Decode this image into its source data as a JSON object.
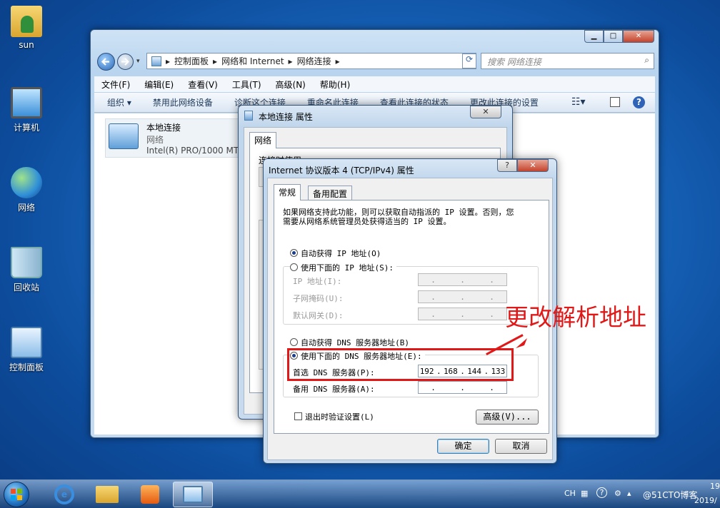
{
  "desktop": {
    "icons": [
      {
        "label": "sun"
      },
      {
        "label": "计算机"
      },
      {
        "label": "网络"
      },
      {
        "label": "回收站"
      },
      {
        "label": "控制面板"
      }
    ]
  },
  "explorer": {
    "min": "▁",
    "max": "□",
    "close": "✕",
    "breadcrumb": [
      "控制面板",
      "网络和 Internet",
      "网络连接"
    ],
    "search_placeholder": "搜索 网络连接",
    "menu": [
      "文件(F)",
      "编辑(E)",
      "查看(V)",
      "工具(T)",
      "高级(N)",
      "帮助(H)"
    ],
    "commands": [
      "组织 ▾",
      "禁用此网络设备",
      "诊断这个连接",
      "重命名此连接",
      "查看此连接的状态",
      "更改此连接的设置"
    ],
    "adapter": {
      "name": "本地连接",
      "network": "网络",
      "device": "Intel(R) PRO/1000 MT"
    }
  },
  "local_props": {
    "title": "本地连接 属性",
    "close": "✕",
    "tab": "网络",
    "connect_using": "连接时使用:"
  },
  "ipv4": {
    "title": "Internet 协议版本 4 (TCP/IPv4) 属性",
    "help": "?",
    "close": "✕",
    "tabs": [
      "常规",
      "备用配置"
    ],
    "description": "如果网络支持此功能，则可以获取自动指派的 IP 设置。否则，您需要从网络系统管理员处获得适当的 IP 设置。",
    "auto_ip": "自动获得 IP 地址(O)",
    "manual_ip": "使用下面的 IP 地址(S):",
    "ip_label": "IP 地址(I):",
    "mask_label": "子网掩码(U):",
    "gateway_label": "默认网关(D):",
    "auto_dns": "自动获得 DNS 服务器地址(B)",
    "manual_dns": "使用下面的 DNS 服务器地址(E):",
    "preferred_dns_label": "首选 DNS 服务器(P):",
    "preferred_dns": [
      "192",
      "168",
      "144",
      "133"
    ],
    "alternate_dns_label": "备用 DNS 服务器(A):",
    "validate": "退出时验证设置(L)",
    "advanced": "高级(V)...",
    "ok": "确定",
    "cancel": "取消"
  },
  "annotation": {
    "text": "更改解析地址",
    "color": "#e01818"
  },
  "taskbar": {
    "lang": "CH",
    "clock": "19",
    "year": "2019/",
    "watermark": "@51CTO博客"
  }
}
